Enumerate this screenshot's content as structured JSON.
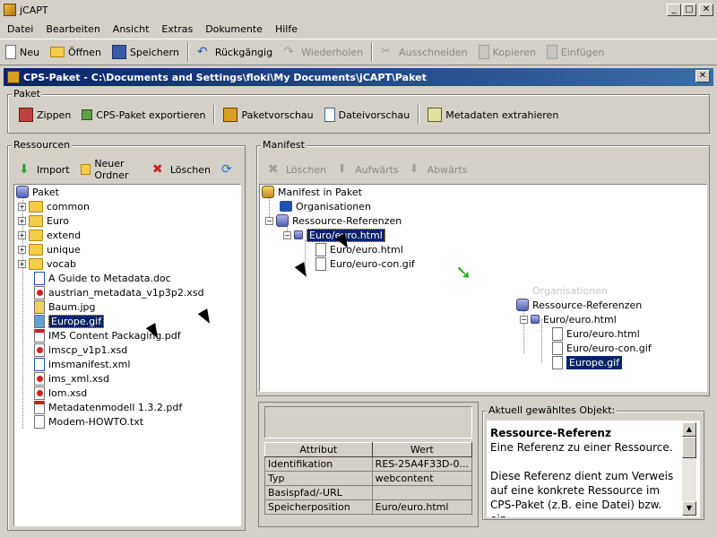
{
  "window": {
    "title": "jCAPT",
    "minimize": "_",
    "maximize": "□",
    "close": "✕"
  },
  "menu": [
    "Datei",
    "Bearbeiten",
    "Ansicht",
    "Extras",
    "Dokumente",
    "Hilfe"
  ],
  "toolbar": {
    "new": "Neu",
    "open": "Öffnen",
    "save": "Speichern",
    "undo": "Rückgängig",
    "redo": "Wiederholen",
    "cut": "Ausschneiden",
    "copy": "Kopieren",
    "paste": "Einfügen"
  },
  "document": {
    "title": "CPS-Paket - C:\\Documents and Settings\\floki\\My Documents\\jCAPT\\Paket",
    "close": "✕"
  },
  "paket": {
    "label": "Paket",
    "zip": "Zippen",
    "export": "CPS-Paket exportieren",
    "preview_package": "Paketvorschau",
    "preview_file": "Dateivorschau",
    "extract_metadata": "Metadaten extrahieren"
  },
  "ressourcen": {
    "label": "Ressourcen",
    "import": "Import",
    "new_folder": "Neuer Ordner",
    "delete": "Löschen",
    "tree": {
      "root": "Paket",
      "folders": [
        "common",
        "Euro",
        "extend",
        "unique",
        "vocab"
      ],
      "files": [
        "A Guide to Metadata.doc",
        "austrian_metadata_v1p3p2.xsd",
        "Baum.jpg",
        "Europe.gif",
        "IMS Content Packaging.pdf",
        "imscp_v1p1.xsd",
        "imsmanifest.xml",
        "ims_xml.xsd",
        "lom.xsd",
        "Metadatenmodell 1.3.2.pdf",
        "Modem-HOWTO.txt"
      ]
    }
  },
  "manifest": {
    "label": "Manifest",
    "delete": "Löschen",
    "up": "Aufwärts",
    "down": "Abwärts",
    "tree": {
      "root": "Manifest in Paket",
      "organisations": "Organisationen",
      "resource_refs": "Ressource-Referenzen",
      "resource": "Euro/euro.html",
      "children": [
        "Euro/euro.html",
        "Euro/euro-con.gif"
      ]
    },
    "after_tree": {
      "ghost": "Organisationen",
      "resource_refs": "Ressource-Referenzen",
      "resource": "Euro/euro.html",
      "children": [
        "Euro/euro.html",
        "Euro/euro-con.gif",
        "Europe.gif"
      ]
    }
  },
  "attributes": {
    "headers": [
      "Attribut",
      "Wert"
    ],
    "rows": [
      [
        "Identifikation",
        "RES-25A4F33D-0..."
      ],
      [
        "Typ",
        "webcontent"
      ],
      [
        "Basispfad/-URL",
        ""
      ],
      [
        "Speicherposition",
        "Euro/euro.html"
      ]
    ]
  },
  "info": {
    "label": "Aktuell gewähltes Objekt:",
    "title": "Ressource-Referenz",
    "line1": "Eine Referenz zu einer Ressource.",
    "para": "Diese Referenz dient zum Verweis auf eine konkrete Ressource im CPS-Paket (z.B. eine Datei) bzw. ein"
  },
  "colors": {
    "face": "#d4d0c8",
    "selection": "#0a246a",
    "title_gradient_start": "#0a246a",
    "title_gradient_end": "#3a6ea5"
  }
}
